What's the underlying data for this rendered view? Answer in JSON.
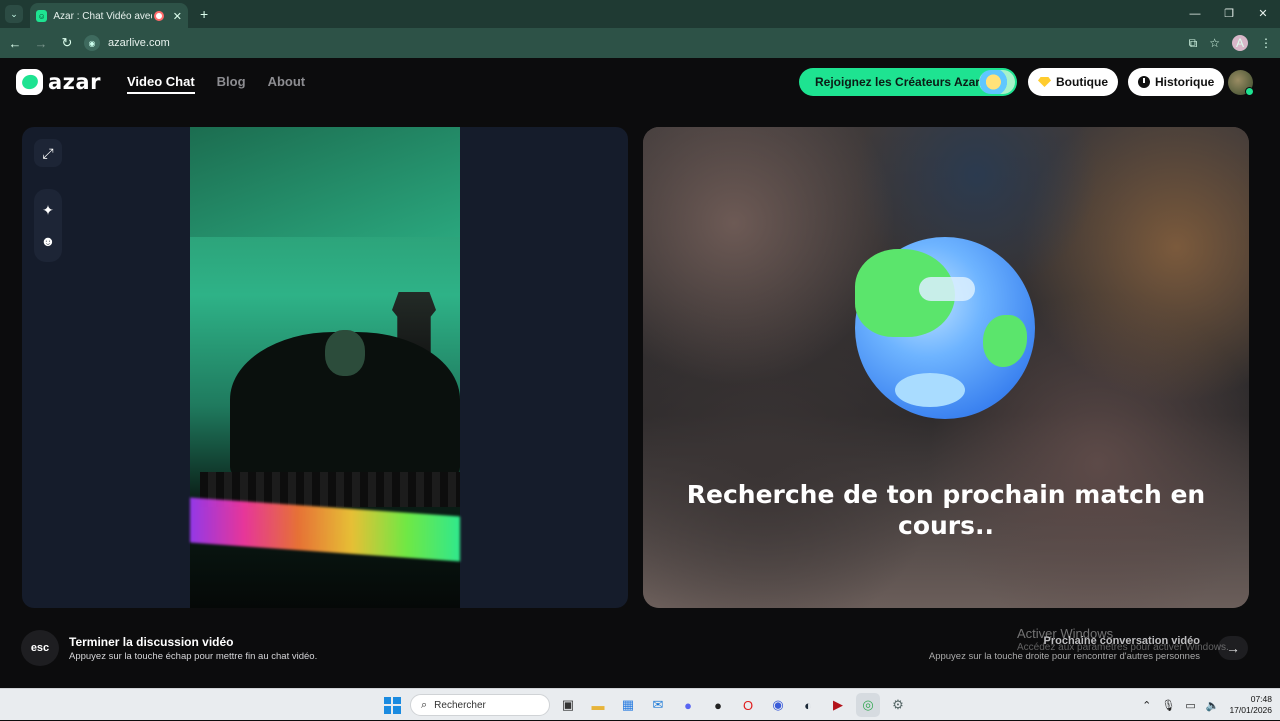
{
  "browser": {
    "tab_title": "Azar : Chat Vidéo avec de n",
    "url": "azarlive.com",
    "profile_initial": "A"
  },
  "site": {
    "logo_text": "azar",
    "nav": [
      "Video Chat",
      "Blog",
      "About"
    ],
    "creators_label": "Rejoignez les Créateurs Azar",
    "shop_label": "Boutique",
    "history_label": "Historique"
  },
  "match": {
    "status_text": "Recherche de ton prochain match en cours.."
  },
  "controls": {
    "esc_key": "esc",
    "end_title": "Terminer la discussion vidéo",
    "end_hint": "Appuyez sur la touche échap pour mettre fin au chat vidéo.",
    "next_title": "Prochaine conversation vidéo",
    "next_hint": "Appuyez sur la touche droite pour rencontrer d'autres personnes"
  },
  "watermark": {
    "title": "Activer Windows",
    "subtitle": "Accédez aux paramètres pour activer Windows."
  },
  "taskbar": {
    "search_placeholder": "Rechercher",
    "time": "07:48",
    "date": "17/01/2026"
  },
  "colors": {
    "brand_green": "#1ee391",
    "chrome_green": "#2d5247"
  }
}
